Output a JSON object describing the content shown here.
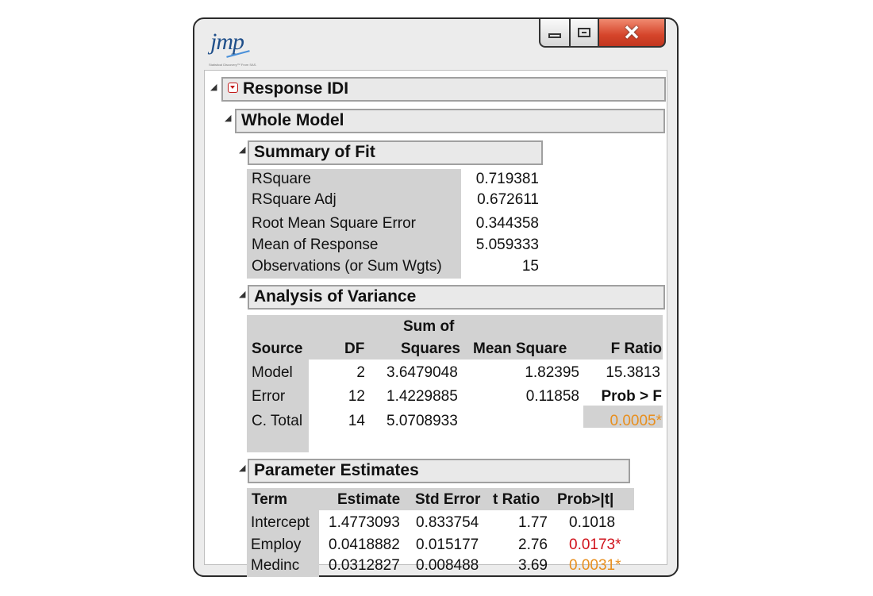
{
  "window": {
    "logo": "jmp",
    "logo_subtitle": "Statistical Discovery™ From SAS.",
    "controls": {
      "minimize": "minimize",
      "maximize": "maximize",
      "close": "close"
    }
  },
  "report": {
    "response_title": "Response IDI",
    "whole_model_title": "Whole Model",
    "summary_of_fit": {
      "title": "Summary of Fit",
      "rows": [
        {
          "label": "RSquare",
          "value": "0.719381"
        },
        {
          "label": "RSquare Adj",
          "value": "0.672611"
        },
        {
          "label": "Root Mean Square Error",
          "value": "0.344358"
        },
        {
          "label": "Mean of Response",
          "value": "5.059333"
        },
        {
          "label": "Observations (or Sum Wgts)",
          "value": "15"
        }
      ]
    },
    "anova": {
      "title": "Analysis of Variance",
      "headers": {
        "source": "Source",
        "df": "DF",
        "ss_line1": "Sum of",
        "ss_line2": "Squares",
        "ms": "Mean Square",
        "f": "F Ratio"
      },
      "rows": [
        {
          "source": "Model",
          "df": "2",
          "ss": "3.6479048",
          "ms": "1.82395",
          "f": "15.3813"
        },
        {
          "source": "Error",
          "df": "12",
          "ss": "1.4229885",
          "ms": "0.11858",
          "f": "Prob > F"
        },
        {
          "source": "C. Total",
          "df": "14",
          "ss": "5.0708933",
          "ms": "",
          "f": "0.0005*"
        }
      ]
    },
    "parameter_estimates": {
      "title": "Parameter Estimates",
      "headers": {
        "term": "Term",
        "estimate": "Estimate",
        "std_error": "Std Error",
        "t_ratio": "t Ratio",
        "prob": "Prob>|t|"
      },
      "rows": [
        {
          "term": "Intercept",
          "estimate": "1.4773093",
          "std_error": "0.833754",
          "t_ratio": "1.77",
          "prob": "0.1018"
        },
        {
          "term": "Employ",
          "estimate": "0.0418882",
          "std_error": "0.015177",
          "t_ratio": "2.76",
          "prob": "0.0173*"
        },
        {
          "term": "Medinc",
          "estimate": "0.0312827",
          "std_error": "0.008488",
          "t_ratio": "3.69",
          "prob": "0.0031*"
        }
      ]
    },
    "colors": {
      "significant_orange": "#e88f1e",
      "significant_red": "#d0121b",
      "header_shade": "#d2d2d2"
    }
  }
}
